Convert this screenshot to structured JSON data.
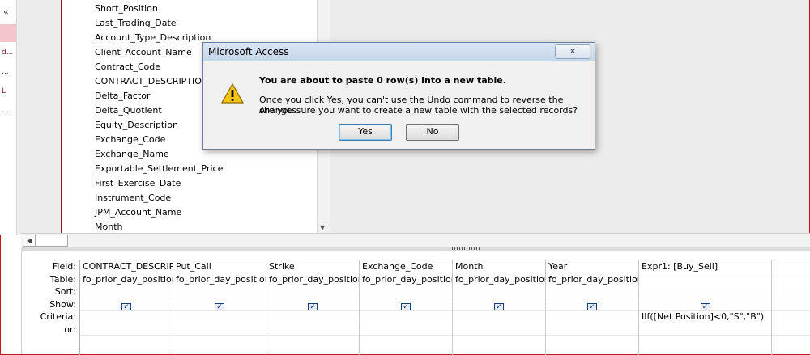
{
  "nav": {
    "chevron": "«",
    "labels": [
      "d...",
      "...",
      "L",
      "..."
    ]
  },
  "field_list": [
    "Short_Position",
    "Last_Trading_Date",
    "Account_Type_Description",
    "Client_Account_Name",
    "Contract_Code",
    "CONTRACT_DESCRIPTION",
    "Delta_Factor",
    "Delta_Quotient",
    "Equity_Description",
    "Exchange_Code",
    "Exchange_Name",
    "Exportable_Settlement_Price",
    "First_Exercise_Date",
    "Instrument_Code",
    "JPM_Account_Name",
    "Month"
  ],
  "grid": {
    "row_labels": [
      "Field:",
      "Table:",
      "Sort:",
      "Show:",
      "Criteria:",
      "or:"
    ],
    "columns": [
      {
        "field": "CONTRACT_DESCRIPTI",
        "table": "fo_prior_day_position",
        "show": true,
        "criteria": ""
      },
      {
        "field": "Put_Call",
        "table": "fo_prior_day_position",
        "show": true,
        "criteria": ""
      },
      {
        "field": "Strike",
        "table": "fo_prior_day_position",
        "show": true,
        "criteria": ""
      },
      {
        "field": "Exchange_Code",
        "table": "fo_prior_day_position",
        "show": true,
        "criteria": ""
      },
      {
        "field": "Month",
        "table": "fo_prior_day_position",
        "show": true,
        "criteria": ""
      },
      {
        "field": "Year",
        "table": "fo_prior_day_position",
        "show": true,
        "criteria": ""
      },
      {
        "field": "Expr1: [Buy_Sell]",
        "table": "",
        "show": true,
        "criteria": "IIf([Net Position]<0,\"S\",\"B\")"
      },
      {
        "field": "",
        "table": "",
        "show": false,
        "criteria": ""
      }
    ]
  },
  "dialog": {
    "title": "Microsoft Access",
    "close": "✕",
    "message_bold": "You are about to paste 0 row(s) into a new table.",
    "message_line1": "Once you click Yes, you can't use the Undo command to reverse the changes.",
    "message_line2": "Are you sure you want to create a new table with the selected records?",
    "yes": "Yes",
    "no": "No",
    "icon": "warning-icon"
  },
  "colors": {
    "frame": "#c8141e",
    "accent": "#8c1c26"
  }
}
